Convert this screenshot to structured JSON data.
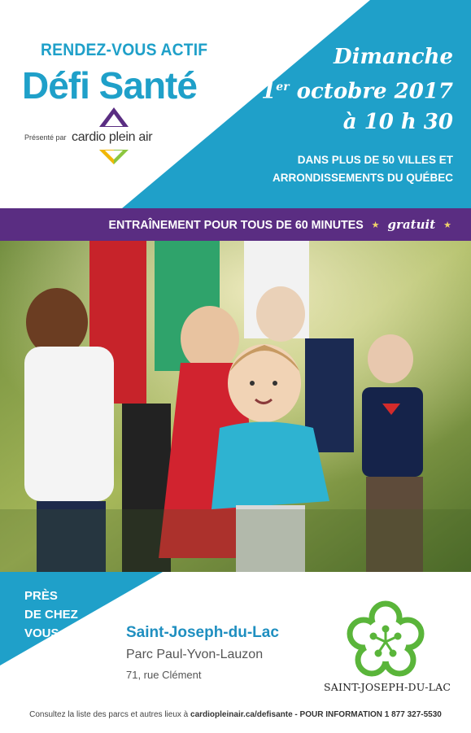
{
  "header": {
    "slogan": "RENDEZ-VOUS ACTIF",
    "brand": "Défi Santé",
    "presented_by": "Présenté par",
    "sponsor": "cardio plein air"
  },
  "event": {
    "day": "Dimanche",
    "date_num": "1",
    "date_sup": "er",
    "date_rest": " octobre 2017",
    "time": "à 10 h 30",
    "cities_line1": "DANS PLUS DE 50 VILLES ET",
    "cities_line2": "ARRONDISSEMENTS DU QUÉBEC"
  },
  "banner": {
    "main": "ENTRAÎNEMENT POUR TOUS DE 60 MINUTES",
    "star": "★",
    "free": "gratuit"
  },
  "location": {
    "near_line1": "PRÈS",
    "near_line2": "DE CHEZ",
    "near_line3": "VOUS :",
    "city": "Saint-Joseph-du-Lac",
    "park": "Parc Paul-Yvon-Lauzon",
    "address": "71, rue Clément",
    "municipality": "SAINT-JOSEPH-DU-LAC"
  },
  "footer": {
    "text": "Consultez la liste des parcs et autres lieux à",
    "url": "cardiopleinair.ca/defisante",
    "info": "- POUR INFORMATION 1 877 327-5530"
  },
  "colors": {
    "accent_blue": "#1fa0c9",
    "purple": "#5a2d82",
    "logo_green": "#5ab53a"
  },
  "icons": {
    "sponsor_logo": "triangle-chevron-icon",
    "municipality_logo": "flower-icon"
  }
}
